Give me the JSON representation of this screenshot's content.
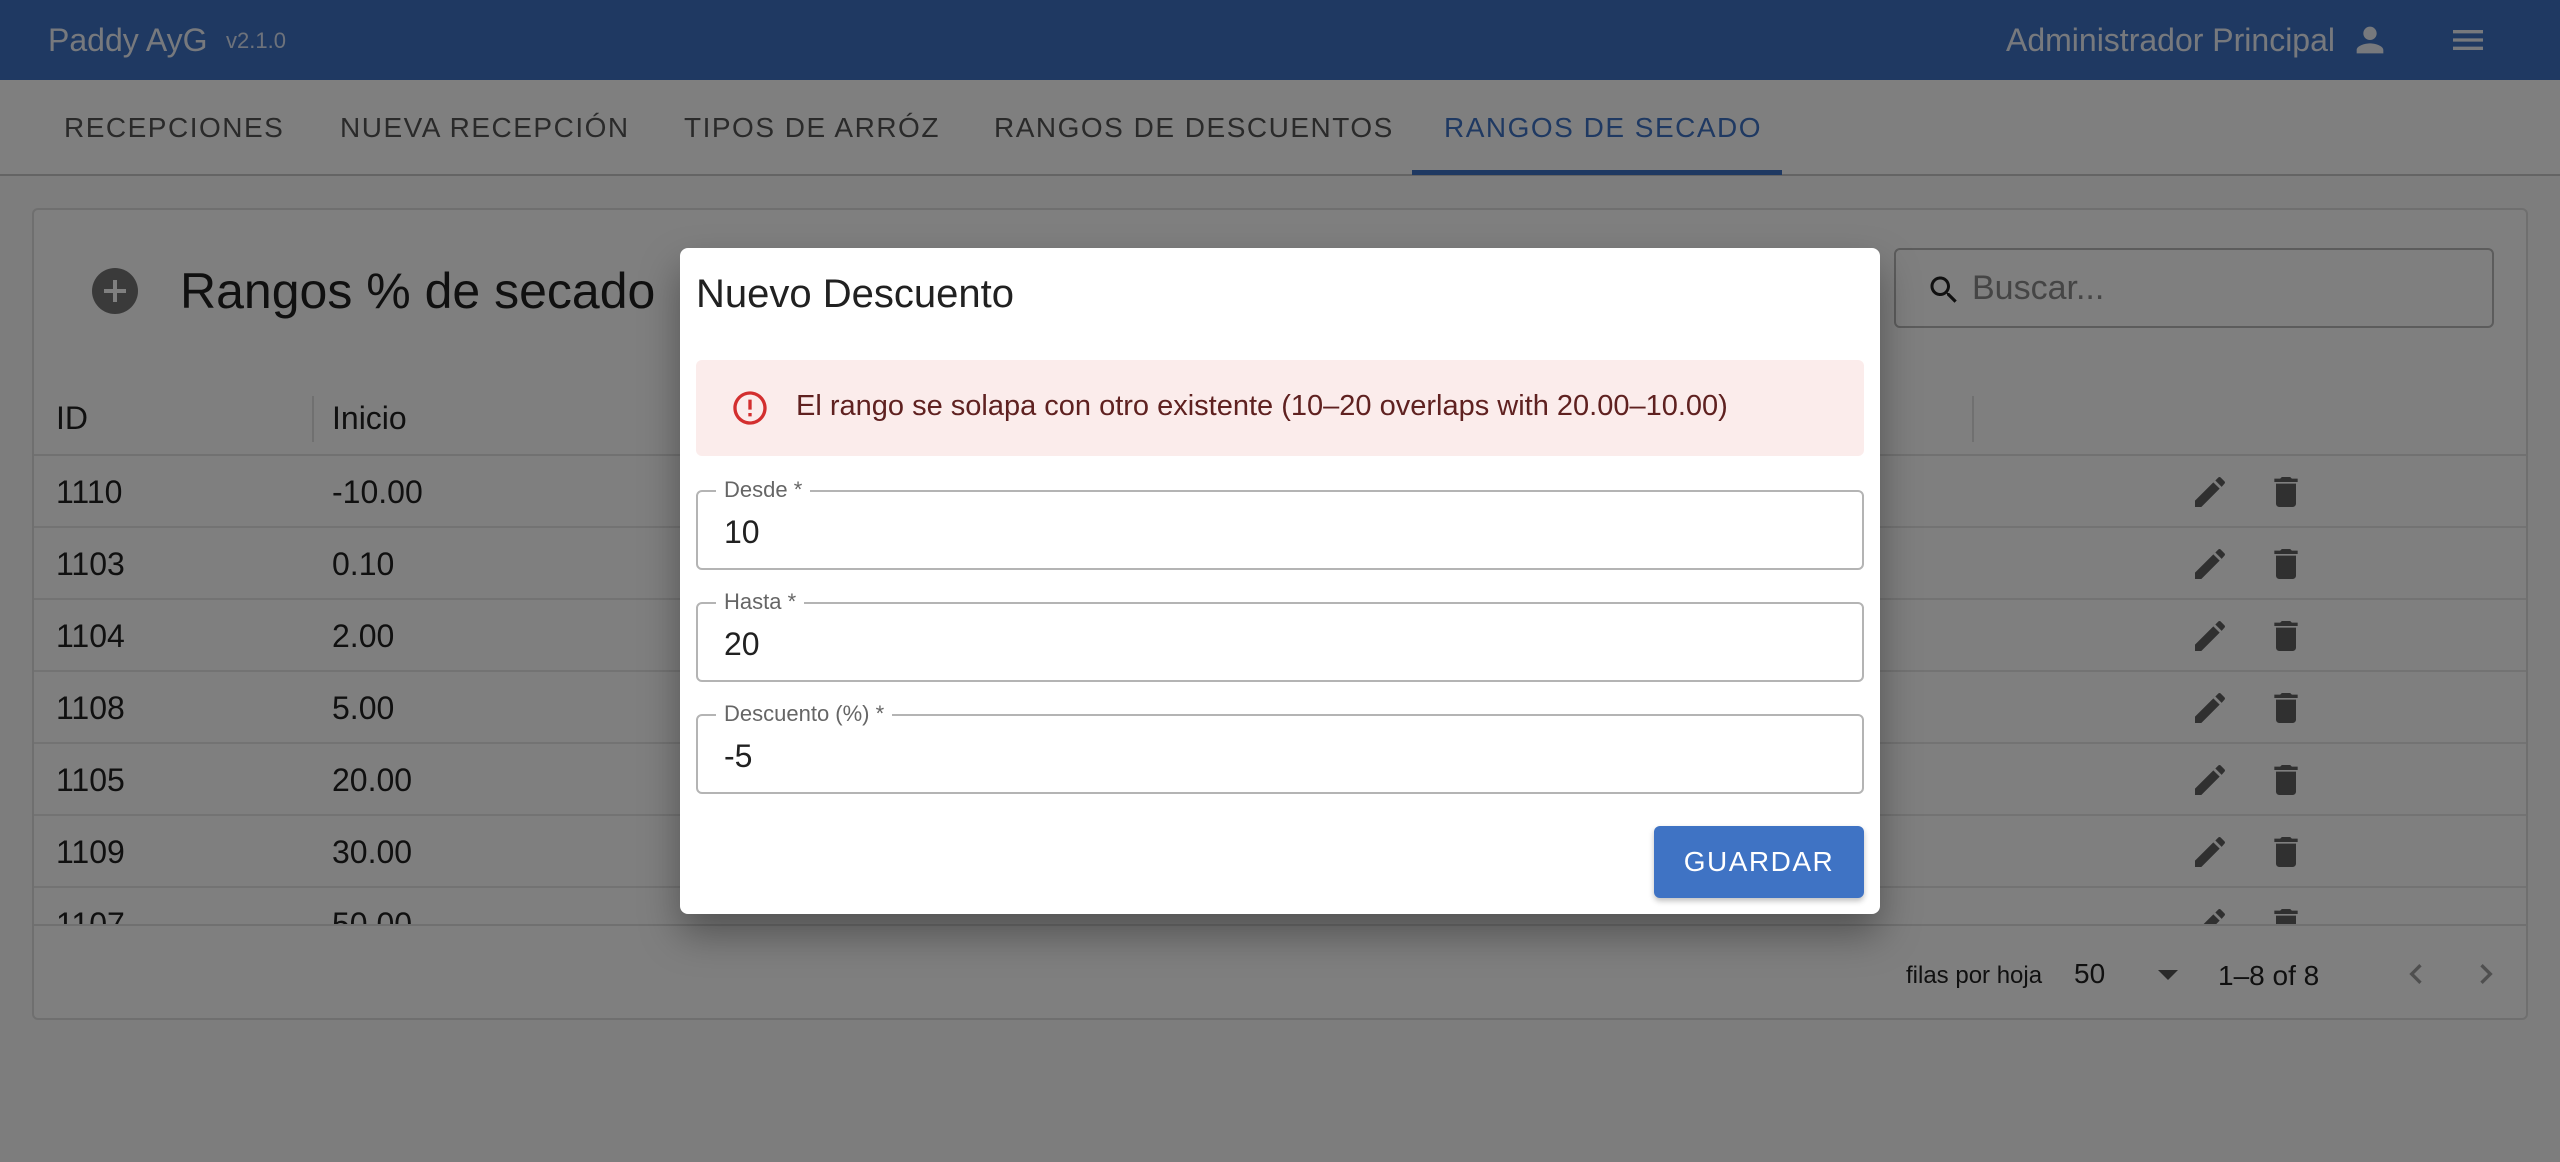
{
  "app": {
    "title": "Paddy AyG",
    "version": "v2.1.0",
    "user_name": "Administrador Principal",
    "accent_color": "#3f73c4"
  },
  "tabs": [
    {
      "label": "RECEPCIONES",
      "active": false
    },
    {
      "label": "NUEVA RECEPCIÓN",
      "active": false
    },
    {
      "label": "TIPOS DE ARRÓZ",
      "active": false
    },
    {
      "label": "RANGOS DE DESCUENTOS",
      "active": false
    },
    {
      "label": "RANGOS DE SECADO",
      "active": true
    }
  ],
  "page": {
    "title": "Rangos % de secado",
    "search": {
      "placeholder": "Buscar...",
      "value": ""
    },
    "columns": [
      "ID",
      "Inicio"
    ],
    "rows": [
      {
        "id": "1110",
        "inicio": "-10.00"
      },
      {
        "id": "1103",
        "inicio": "0.10"
      },
      {
        "id": "1104",
        "inicio": "2.00"
      },
      {
        "id": "1108",
        "inicio": "5.00"
      },
      {
        "id": "1105",
        "inicio": "20.00"
      },
      {
        "id": "1109",
        "inicio": "30.00"
      },
      {
        "id": "1107",
        "inicio": "50.00"
      }
    ],
    "pagination": {
      "rows_per_page_label": "filas por hoja",
      "rows_per_page": "50",
      "range": "1–8 of 8"
    }
  },
  "dialog": {
    "title": "Nuevo Descuento",
    "error": "El rango se solapa con otro existente (10–20 overlaps with 20.00–10.00)",
    "fields": {
      "desde": {
        "label": "Desde *",
        "value": "10"
      },
      "hasta": {
        "label": "Hasta *",
        "value": "20"
      },
      "descuento": {
        "label": "Descuento (%) *",
        "value": "-5"
      }
    },
    "save_label": "GUARDAR"
  }
}
